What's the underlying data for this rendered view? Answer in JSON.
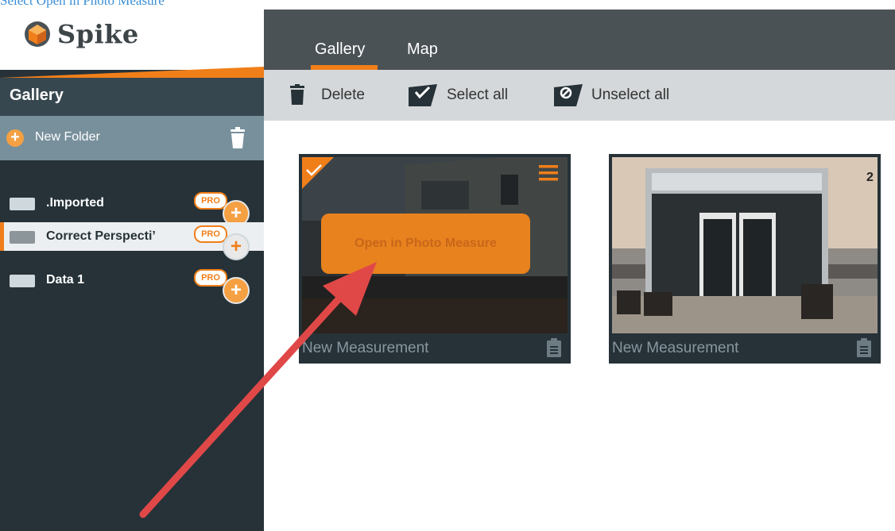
{
  "caption": {
    "text": "Select Open in Photo Measure"
  },
  "app": {
    "name": "Spike"
  },
  "sidebar": {
    "title": "Gallery",
    "new_folder_label": "New Folder",
    "folders": [
      {
        "label": ".Imported",
        "badge": "PRO"
      },
      {
        "label": "Correct Perspecti’",
        "badge": "PRO"
      },
      {
        "label": "Data 1",
        "badge": "PRO"
      }
    ]
  },
  "tabs": [
    {
      "label": "Gallery"
    },
    {
      "label": "Map"
    }
  ],
  "toolbar": {
    "delete_label": "Delete",
    "select_all_label": "Select all",
    "unselect_all_label": "Unselect all"
  },
  "cards": [
    {
      "caption": "New Measurement",
      "selected": true,
      "action_label": "Open in Photo Measure"
    },
    {
      "caption": "New Measurement",
      "selected": false
    }
  ],
  "colors": {
    "accent": "#f07f1a",
    "sidebar": "#263238",
    "topbar": "#4a5256",
    "toolbar": "#d5d8da",
    "arrow": "#e04848"
  }
}
